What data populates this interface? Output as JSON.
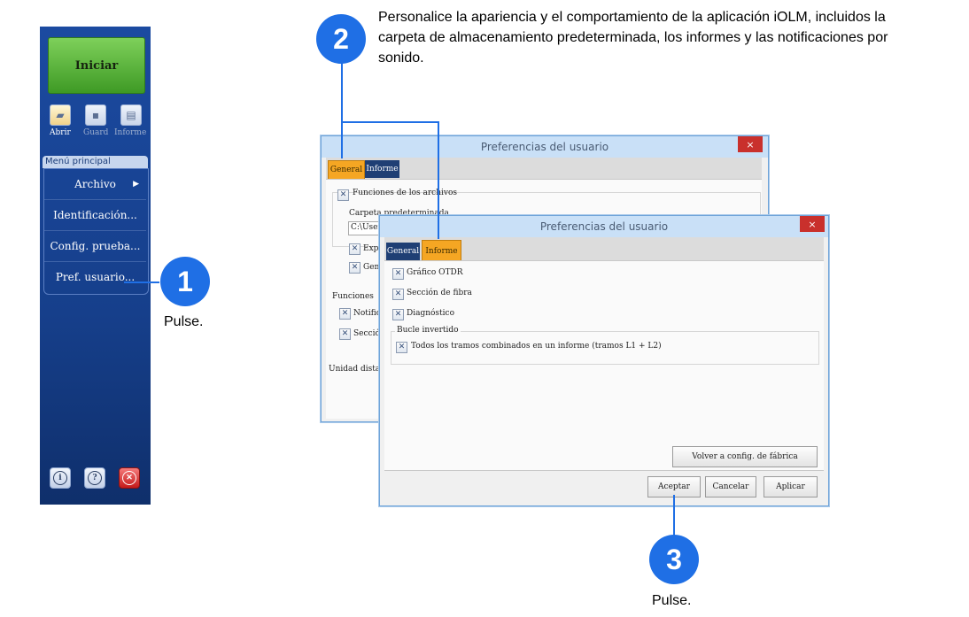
{
  "app_panel": {
    "start_label": "Iniciar",
    "tools": [
      {
        "label": "Abrir",
        "icon": "folder-open-icon"
      },
      {
        "label": "Guard",
        "icon": "save-icon"
      },
      {
        "label": "Informe",
        "icon": "report-icon"
      }
    ],
    "menu_title": "Menú principal",
    "menu_items": [
      {
        "label": "Archivo"
      },
      {
        "label": "Identificación..."
      },
      {
        "label": "Config. prueba..."
      },
      {
        "label": "Pref. usuario..."
      }
    ],
    "archivo_arrow": "▶",
    "bottom_icons": [
      "info-icon",
      "help-icon",
      "exit-icon"
    ]
  },
  "callouts": {
    "one": {
      "number": "1",
      "caption": "Pulse."
    },
    "two": {
      "number": "2",
      "text": "Personalice la apariencia y el comportamiento de la aplicación iOLM, incluidos la carpeta de almacenamiento predeterminada, los informes y las notificaciones por sonido."
    },
    "three": {
      "number": "3",
      "caption": "Pulse."
    },
    "color": "#1f6fe5"
  },
  "dialog_back": {
    "title": "Preferencias del usuario",
    "close": "×",
    "tabs": [
      "General",
      "Informe"
    ],
    "file_functions": "Funciones de los archivos",
    "default_folder_label": "Carpeta predeterminada",
    "folder_value": "C:\\Users",
    "check_exp": "Expo",
    "check_gen": "Gen",
    "functions_group": "Funciones",
    "check_notif": "Notifica",
    "check_section": "Sección",
    "distance_unit": "Unidad distanc"
  },
  "dialog_front": {
    "title": "Preferencias del usuario",
    "close": "×",
    "tabs": [
      "General",
      "Informe"
    ],
    "checks": [
      "Gráfico OTDR",
      "Sección de fibra",
      "Diagnóstico"
    ],
    "loopback_group": "Bucle invertido",
    "loopback_check": "Todos los tramos combinados en un informe (tramos L1 + L2)",
    "factory_button": "Volver a config. de fábrica",
    "ok_button": "Aceptar",
    "cancel_button": "Cancelar",
    "apply_button": "Aplicar"
  },
  "check_mark": "✕"
}
